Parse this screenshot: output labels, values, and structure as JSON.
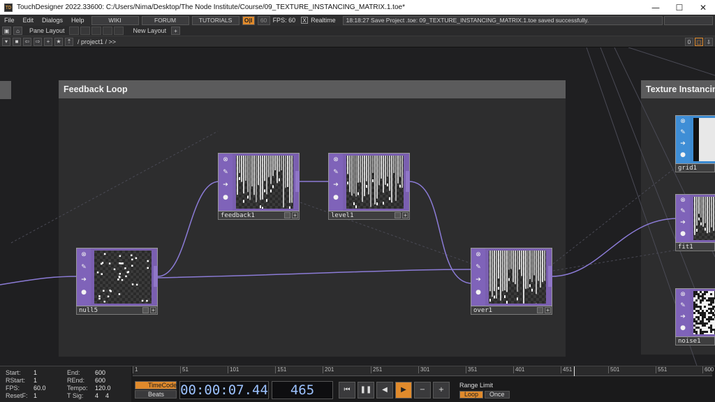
{
  "window": {
    "title": "TouchDesigner 2022.33600: C:/Users/Nima/Desktop/The Node Institute/Course/09_TEXTURE_INSTANCING_MATRIX.1.toe*",
    "minimize_glyph": "—",
    "maximize_glyph": "☐",
    "close_glyph": "✕"
  },
  "menubar": {
    "menus": [
      "File",
      "Edit",
      "Dialogs",
      "Help"
    ],
    "links": [
      "WIKI",
      "FORUM",
      "TUTORIALS"
    ],
    "ol_label": "O|I",
    "fps_value": "60",
    "fps_label": "FPS: 60",
    "realtime_check": "X",
    "realtime_label": "Realtime",
    "status": "18:18:27 Save Project .toe: 09_TEXTURE_INSTANCING_MATRIX.1.toe saved successfully."
  },
  "panebar": {
    "pane_layout": "Pane Layout",
    "new_layout": "New Layout",
    "plus": "+"
  },
  "pathbar": {
    "path": "/ project1 / >>",
    "right_value": "0"
  },
  "network": {
    "annotations": [
      {
        "id": "feedback",
        "title": "Feedback Loop"
      },
      {
        "id": "instancing",
        "title": "Texture Instancing"
      }
    ],
    "nodes": [
      {
        "id": "null5",
        "name": "null5",
        "texture": "dots"
      },
      {
        "id": "feedback1",
        "name": "feedback1",
        "texture": "streaks"
      },
      {
        "id": "level1",
        "name": "level1",
        "texture": "streaks"
      },
      {
        "id": "over1",
        "name": "over1",
        "texture": "streaks"
      },
      {
        "id": "grid1",
        "name": "grid1",
        "texture": "white"
      },
      {
        "id": "fit1",
        "name": "fit1",
        "texture": "streaks"
      },
      {
        "id": "noise1",
        "name": "noise1",
        "texture": "noise"
      }
    ]
  },
  "timeline": {
    "info": [
      {
        "k": "Start:",
        "v": "1"
      },
      {
        "k": "RStart:",
        "v": "1"
      },
      {
        "k": "FPS:",
        "v": "60.0"
      },
      {
        "k": "ResetF:",
        "v": "1"
      },
      {
        "k": "End:",
        "v": "600"
      },
      {
        "k": "REnd:",
        "v": "600"
      },
      {
        "k": "Tempo:",
        "v": "120.0"
      },
      {
        "k": "T Sig:",
        "v": "4    4"
      }
    ],
    "ruler_ticks": [
      "1",
      "51",
      "101",
      "151",
      "201",
      "251",
      "301",
      "351",
      "401",
      "451",
      "501",
      "551",
      "600"
    ],
    "mode_timecode": "TimeCode",
    "mode_beats": "Beats",
    "timecode": "00:00:07.44",
    "frame": "465",
    "range_limit": "Range Limit",
    "loop": "Loop",
    "once": "Once"
  }
}
